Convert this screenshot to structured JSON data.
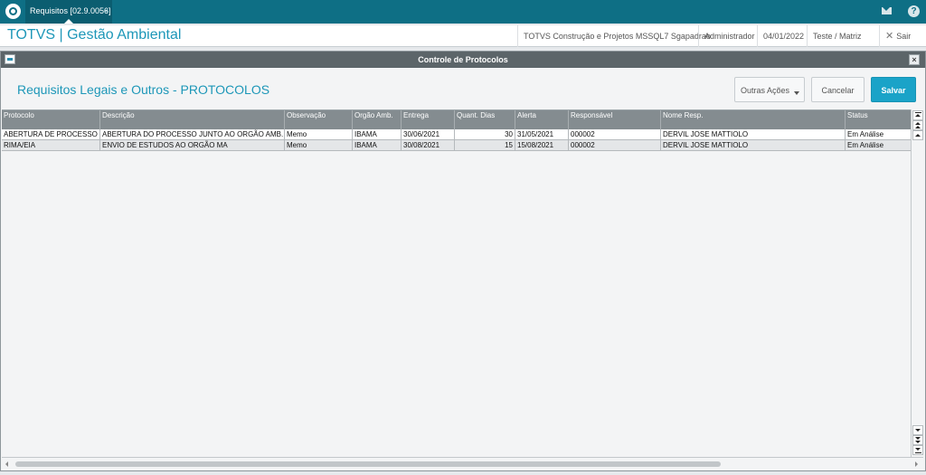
{
  "topbar": {
    "tab_label": "Requisitos [02.9.0056]",
    "tab_close": "×"
  },
  "header": {
    "app_title": "TOTVS | Gestão Ambiental",
    "company": "TOTVS Construção e Projetos MSSQL7 Sgapadrao",
    "user": "Administrador",
    "date": "04/01/2022",
    "branch": "Teste / Matriz",
    "exit_label": "Sair"
  },
  "dialog": {
    "title": "Controle de Protocolos",
    "close_label": "×",
    "heading": "Requisitos Legais e Outros - PROTOCOLOS",
    "buttons": {
      "other_actions": "Outras Ações",
      "cancel": "Cancelar",
      "save": "Salvar"
    }
  },
  "grid": {
    "columns": [
      "Protocolo",
      "Descrição",
      "Observação",
      "Orgão Amb.",
      "Entrega",
      "Quant. Dias",
      "Alerta",
      "Responsável",
      "Nome Resp.",
      "Status"
    ],
    "rows": [
      [
        "ABERTURA DE PROCESSO",
        "ABERTURA DO PROCESSO JUNTO AO ORGÃO AMB.",
        "Memo",
        "IBAMA",
        "30/06/2021",
        "30",
        "31/05/2021",
        "000002",
        "DERVIL JOSE MATTIOLO",
        "Em Análise"
      ],
      [
        "RIMA/EIA",
        "ENVIO DE ESTUDOS AO ORGÃO MA",
        "Memo",
        "IBAMA",
        "30/08/2021",
        "15",
        "15/08/2021",
        "000002",
        "DERVIL JOSE MATTIOLO",
        "Em Análise"
      ]
    ]
  },
  "colors": {
    "topbar": "#0e6f85",
    "accent": "#1d97b8",
    "save_button": "#1aa3c8",
    "grid_header": "#848c90",
    "dialog_titlebar": "#5c6569"
  },
  "icons": {
    "logo": "totvs-logo-icon",
    "mail": "mail-icon",
    "help": "help-icon",
    "exit": "close-icon",
    "dialog": "window-icon"
  }
}
